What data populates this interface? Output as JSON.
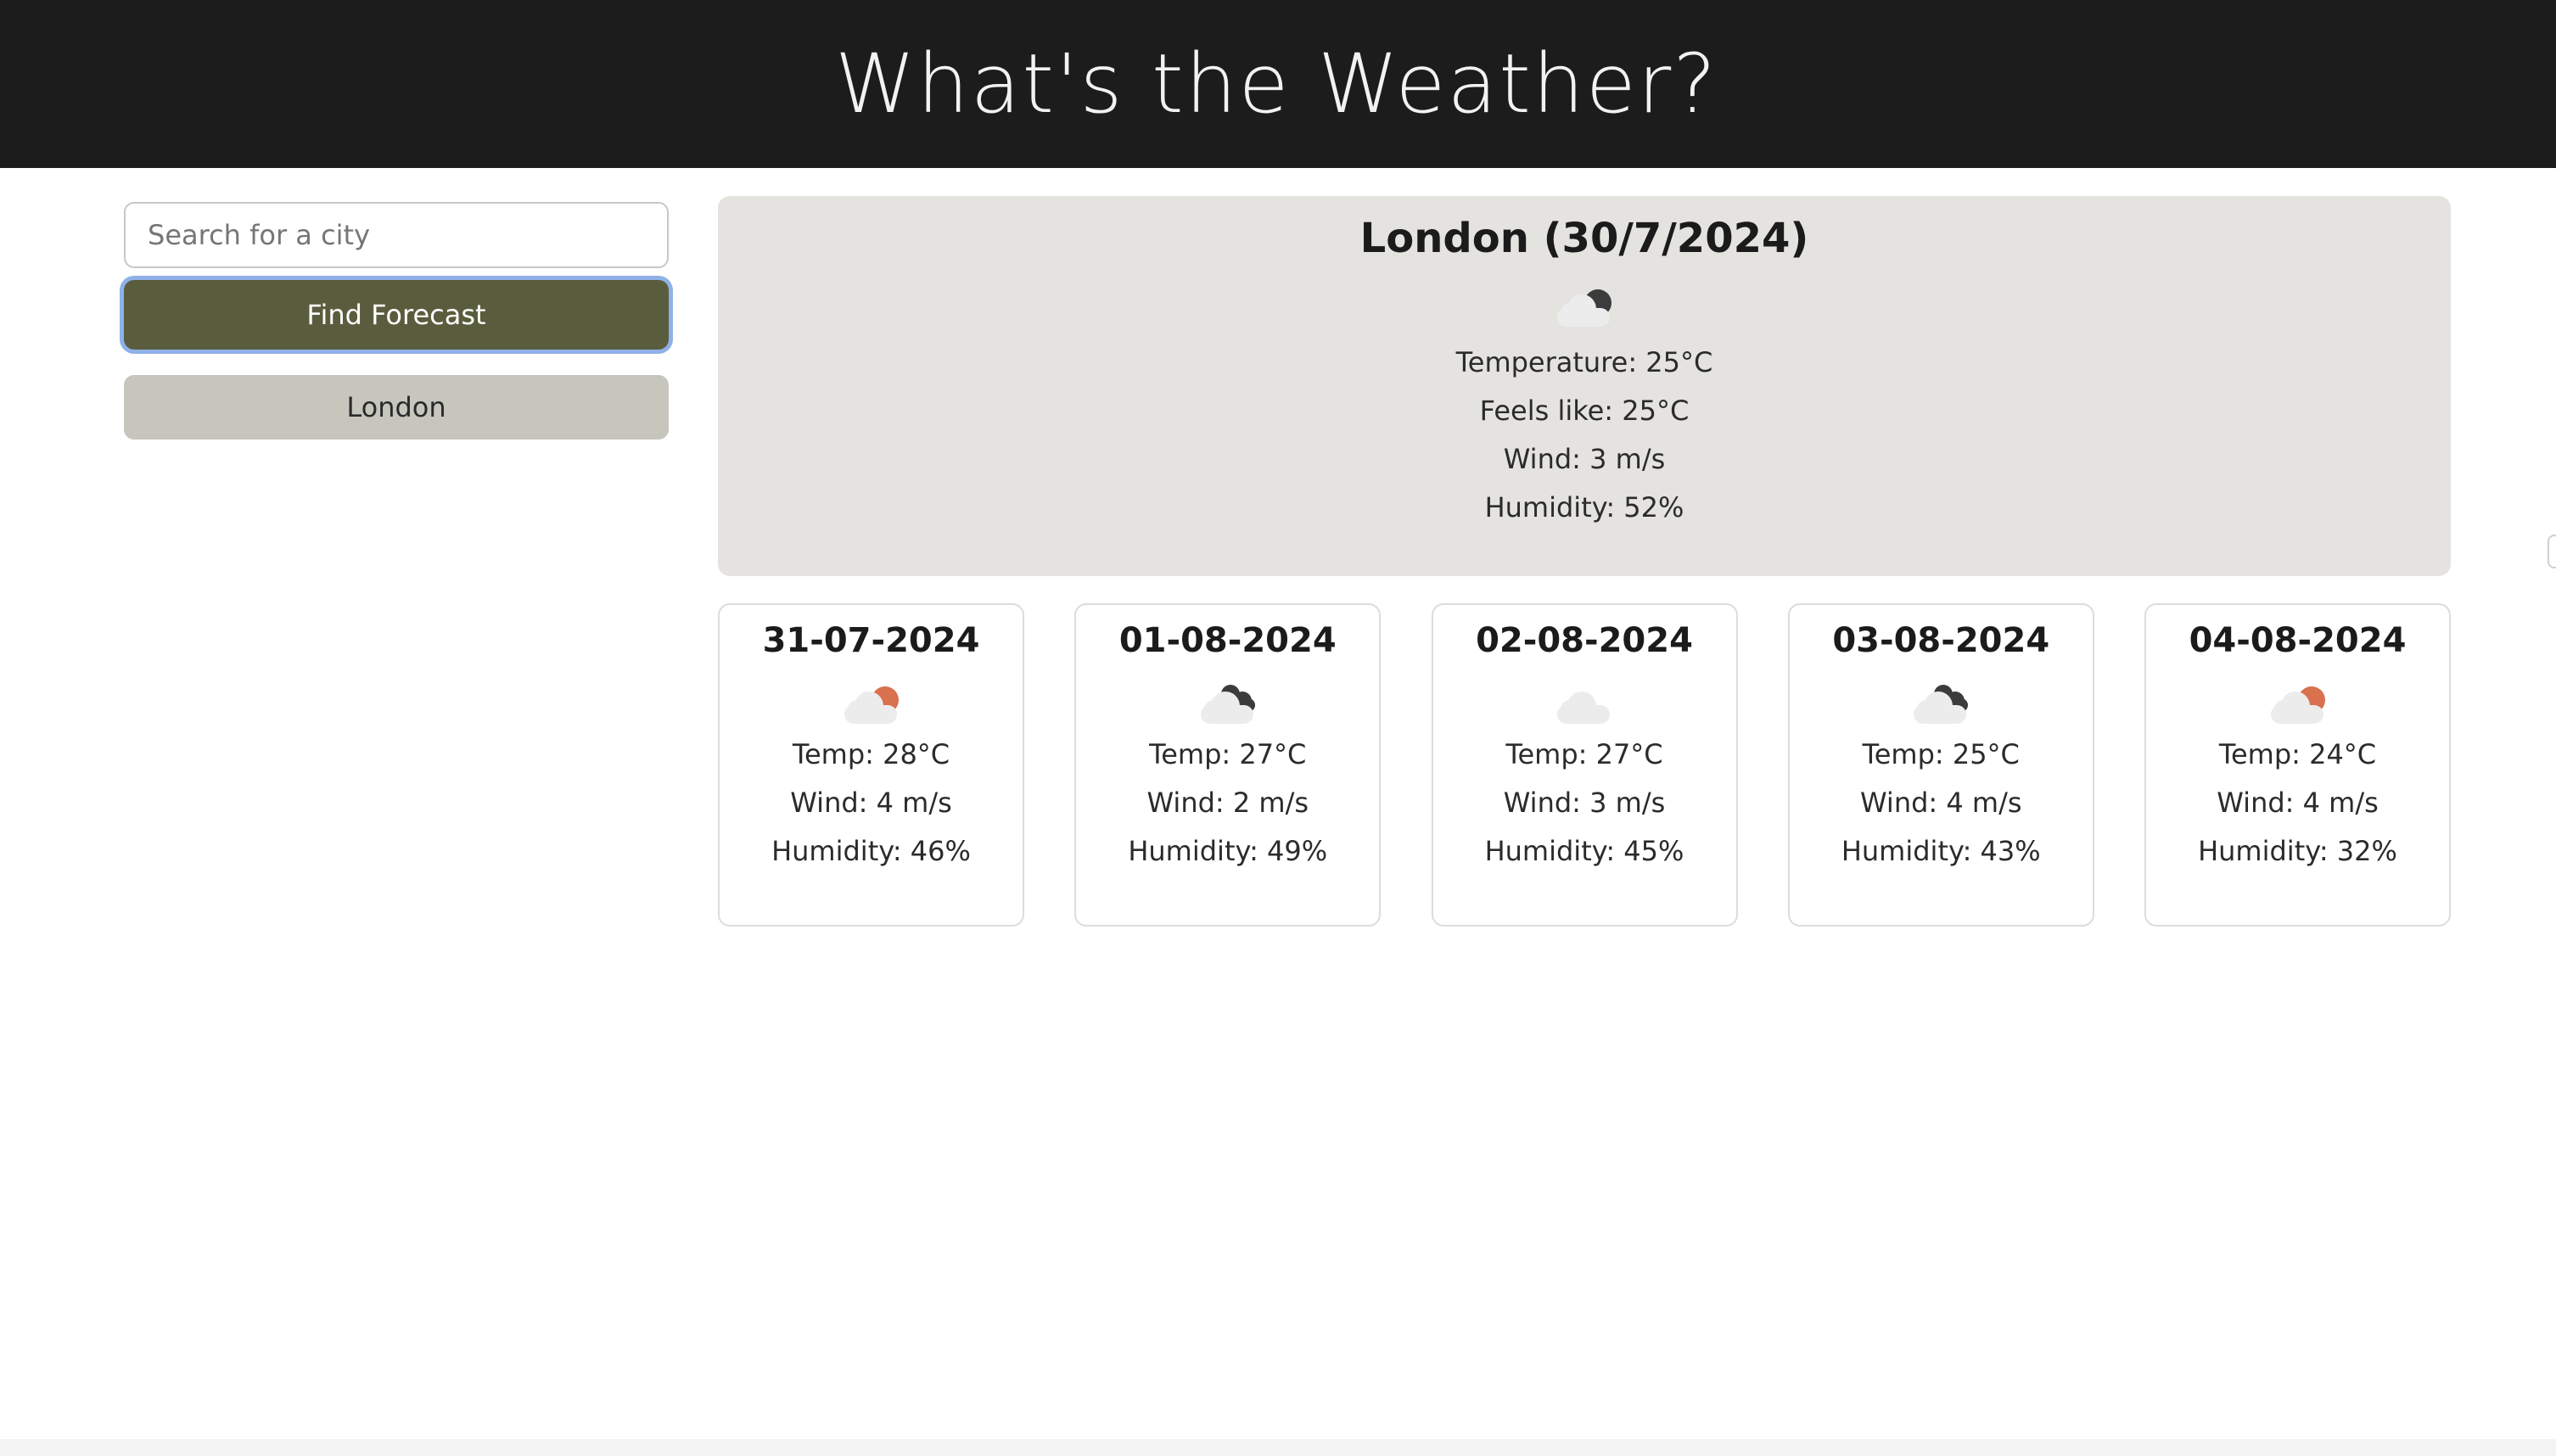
{
  "header": {
    "title": "What's the Weather?"
  },
  "search": {
    "placeholder": "Search for a city",
    "value": "",
    "button_label": "Find Forecast"
  },
  "history": [
    {
      "label": "London"
    }
  ],
  "current": {
    "title": "London (30/7/2024)",
    "icon": "moon-cloud-icon",
    "temperature": "Temperature: 25°C",
    "feels_like": "Feels like: 25°C",
    "wind": "Wind: 3 m/s",
    "humidity": "Humidity: 52%"
  },
  "forecast": [
    {
      "date": "31-07-2024",
      "icon": "sun-cloud-icon",
      "temp": "Temp: 28°C",
      "wind": "Wind: 4 m/s",
      "humidity": "Humidity: 46%"
    },
    {
      "date": "01-08-2024",
      "icon": "dark-clouds-icon",
      "temp": "Temp: 27°C",
      "wind": "Wind: 2 m/s",
      "humidity": "Humidity: 49%"
    },
    {
      "date": "02-08-2024",
      "icon": "cloud-icon",
      "temp": "Temp: 27°C",
      "wind": "Wind: 3 m/s",
      "humidity": "Humidity: 45%"
    },
    {
      "date": "03-08-2024",
      "icon": "dark-clouds-icon",
      "temp": "Temp: 25°C",
      "wind": "Wind: 4 m/s",
      "humidity": "Humidity: 43%"
    },
    {
      "date": "04-08-2024",
      "icon": "sun-cloud-icon",
      "temp": "Temp: 24°C",
      "wind": "Wind: 4 m/s",
      "humidity": "Humidity: 32%"
    }
  ],
  "colors": {
    "header_bg": "#1c1c1c",
    "button_bg": "#5a5d3d",
    "history_bg": "#c6c6bd",
    "current_bg": "#e4e3df",
    "sun": "#d9704e",
    "dark": "#3c3c3c"
  }
}
